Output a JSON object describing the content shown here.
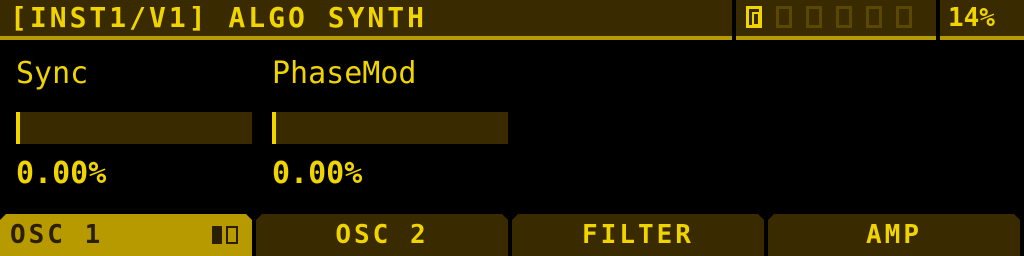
{
  "header": {
    "title": "[INST1/V1] ALGO SYNTH",
    "page_count": 6,
    "active_page": 1,
    "cpu": "14%"
  },
  "params": [
    {
      "label": "Sync",
      "value": "0.00%",
      "level": 0.0
    },
    {
      "label": "PhaseMod",
      "value": "0.00%",
      "level": 0.0
    }
  ],
  "tabs": [
    {
      "label": "OSC 1",
      "active": true
    },
    {
      "label": "OSC 2",
      "active": false
    },
    {
      "label": "FILTER",
      "active": false
    },
    {
      "label": "AMP",
      "active": false
    }
  ],
  "colors": {
    "accent": "#f0d400",
    "dim": "#3a2a00",
    "active_tab": "#b79a00",
    "background": "#000000"
  }
}
